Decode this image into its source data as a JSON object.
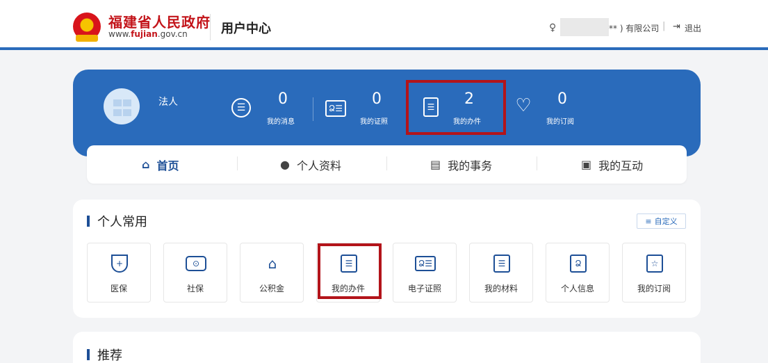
{
  "header": {
    "site_title": "福建省人民政府",
    "site_url_prefix": "www.",
    "site_url_brand": "fujian",
    "site_url_suffix": ".gov.cn",
    "center_title": "用户中心",
    "user_name_tail": "** ) 有限公司",
    "separator": "|",
    "logout_label": "退出"
  },
  "banner": {
    "role": "法人",
    "stats": [
      {
        "icon": "message-icon",
        "value": "0",
        "label": "我的消息"
      },
      {
        "icon": "certificate-icon",
        "value": "0",
        "label": "我的证照"
      },
      {
        "icon": "clipboard-icon",
        "value": "2",
        "label": "我的办件"
      },
      {
        "icon": "heart-icon",
        "value": "0",
        "label": "我的订阅"
      }
    ]
  },
  "tabs": [
    {
      "label": "首页",
      "icon": "home-icon",
      "active": true
    },
    {
      "label": "个人资料",
      "icon": "person-icon",
      "active": false
    },
    {
      "label": "我的事务",
      "icon": "task-icon",
      "active": false
    },
    {
      "label": "我的互动",
      "icon": "chat-icon",
      "active": false
    }
  ],
  "common": {
    "title": "个人常用",
    "customize_label": "自定义",
    "items": [
      {
        "label": "医保",
        "icon": "shield-plus-icon"
      },
      {
        "label": "社保",
        "icon": "social-security-icon"
      },
      {
        "label": "公积金",
        "icon": "fund-house-icon"
      },
      {
        "label": "我的办件",
        "icon": "document-icon"
      },
      {
        "label": "电子证照",
        "icon": "id-card-icon"
      },
      {
        "label": "我的材料",
        "icon": "materials-icon"
      },
      {
        "label": "个人信息",
        "icon": "personal-info-icon"
      },
      {
        "label": "我的订阅",
        "icon": "star-subscribe-icon"
      }
    ]
  },
  "recommend": {
    "title": "推荐"
  },
  "colors": {
    "brand_blue": "#2a6bbb",
    "highlight_red": "#b3141a",
    "site_title_red": "#c3141a"
  }
}
